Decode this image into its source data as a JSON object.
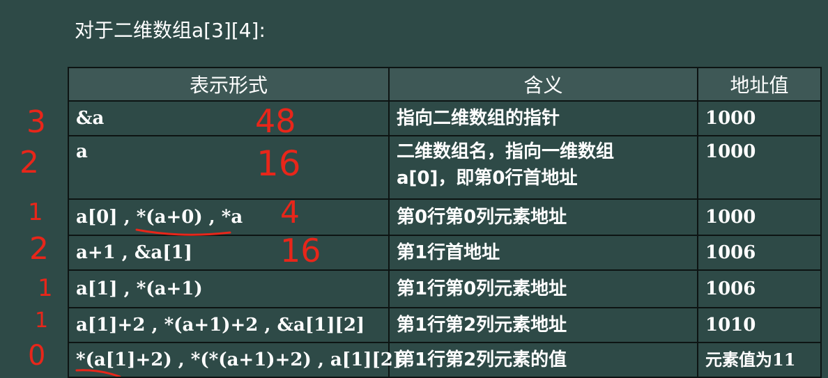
{
  "title": "对于二维数组a[3][4]:",
  "table": {
    "headers": [
      "表示形式",
      "含义",
      "地址值"
    ],
    "rows": [
      {
        "form": "&a",
        "meaning": "指向二维数组的指针",
        "meaning2": "",
        "address": "1000"
      },
      {
        "form": "a",
        "meaning": "二维数组名，指向一维数组",
        "meaning2": "a[0]，即第0行首地址",
        "address": "1000"
      },
      {
        "form": "a[0] , *(a+0) , *a",
        "meaning": "第0行第0列元素地址",
        "meaning2": "",
        "address": "1000"
      },
      {
        "form": "a+1 , &a[1]",
        "meaning": "第1行首地址",
        "meaning2": "",
        "address": "1006"
      },
      {
        "form": "a[1] , *(a+1)",
        "meaning": "第1行第0列元素地址",
        "meaning2": "",
        "address": "1006"
      },
      {
        "form": "a[1]+2 , *(a+1)+2 , &a[1][2]",
        "meaning": "第1行第2列元素地址",
        "meaning2": "",
        "address": "1010"
      },
      {
        "form": "*(a[1]+2) , *(*(a+1)+2) , a[1][2]",
        "meaning": "第1行第2列元素的值",
        "meaning2": "",
        "address": "元素值为11"
      }
    ]
  },
  "annotations": {
    "color": "#e8261a",
    "left_numbers": [
      "3",
      "2",
      "1",
      "2",
      "1",
      "1",
      "0"
    ],
    "inline_numbers": [
      "48",
      "16",
      "4",
      "16"
    ]
  }
}
